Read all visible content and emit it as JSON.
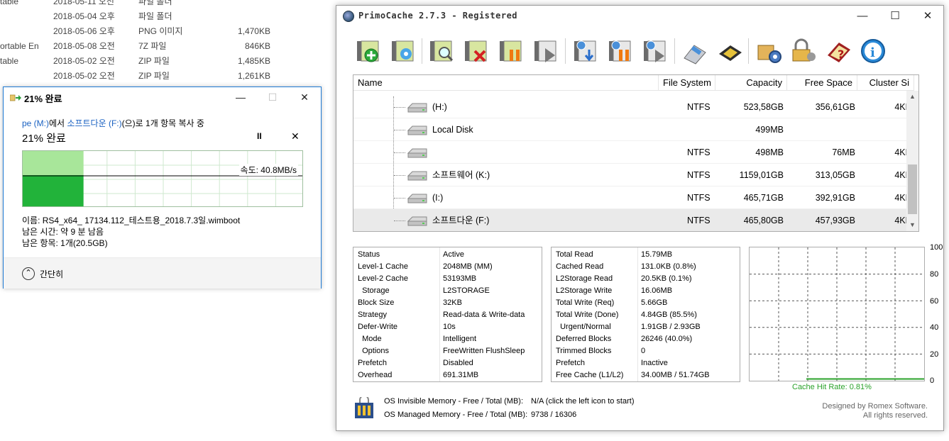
{
  "explorer": {
    "rows": [
      {
        "name": "table",
        "date": "2018-05-11 오전",
        "type": "파일 폴더",
        "size": ""
      },
      {
        "name": "",
        "date": "2018-05-04 오후",
        "type": "파일 폴더",
        "size": ""
      },
      {
        "name": "",
        "date": "2018-05-06 오후",
        "type": "PNG 이미지",
        "size": "1,470KB"
      },
      {
        "name": "ortable En",
        "date": "2018-05-08 오전",
        "type": "7Z 파일",
        "size": "846KB"
      },
      {
        "name": "table",
        "date": "2018-05-02 오전",
        "type": "ZIP 파일",
        "size": "1,485KB"
      },
      {
        "name": "",
        "date": "2018-05-02 오전",
        "type": "ZIP 파일",
        "size": "1,261KB"
      }
    ]
  },
  "copy_dialog": {
    "title": "21% 완료",
    "src_drive": "pe (M:)",
    "from_text": "에서 ",
    "dest_drive": "소프트다운 (F:)",
    "action_text": "(으)로 1개 항목 복사 중",
    "percent_text": "21% 완료",
    "pause_glyph": "II",
    "cancel_glyph": "✕",
    "speed_text": "속도: 40.8MB/s",
    "progress": 0.21,
    "name_line": "이름: RS4_x64_ 17134.112_테스트용_2018.7.3일.wimboot",
    "time_line": "남은 시간: 약 9 분 남음",
    "items_line": "남은 항목: 1개(20.5GB)",
    "collapse_label": "간단히",
    "caption": {
      "minimize": "—",
      "maximize": "☐",
      "close": "✕"
    }
  },
  "primo": {
    "title": "PrimoCache 2.7.3 - Registered",
    "caption": {
      "minimize": "—",
      "maximize": "☐",
      "close": "✕"
    },
    "toolbar": [
      "add-cache",
      "new-task",
      "inspect",
      "remove-cache",
      "pause-cache",
      "play-cache",
      "flush",
      "pause-all",
      "play-all",
      "tools",
      "hardware",
      "settings",
      "security",
      "help",
      "about"
    ],
    "table": {
      "columns": [
        "Name",
        "File System",
        "Capacity",
        "Free Space",
        "Cluster Si"
      ],
      "rows": [
        {
          "name": "(H:)",
          "fs": "NTFS",
          "capacity": "523,58GB",
          "free": "356,61GB",
          "cluster": "4KB",
          "selected": false
        },
        {
          "name": "Local Disk",
          "fs": "",
          "capacity": "499MB",
          "free": "",
          "cluster": "",
          "selected": false
        },
        {
          "name": "",
          "fs": "NTFS",
          "capacity": "498MB",
          "free": "76MB",
          "cluster": "4KB",
          "selected": false
        },
        {
          "name": "소프트웨어 (K:)",
          "fs": "NTFS",
          "capacity": "1159,01GB",
          "free": "313,05GB",
          "cluster": "4KB",
          "selected": false
        },
        {
          "name": "(I:)",
          "fs": "NTFS",
          "capacity": "465,71GB",
          "free": "392,91GB",
          "cluster": "4KB",
          "selected": false
        },
        {
          "name": "소프트다운 (F:)",
          "fs": "NTFS",
          "capacity": "465,80GB",
          "free": "457,93GB",
          "cluster": "4KB",
          "selected": true
        }
      ]
    },
    "status_left": [
      {
        "k": "Status",
        "v": "Active"
      },
      {
        "k": "Level-1 Cache",
        "v": "2048MB (MM)"
      },
      {
        "k": "Level-2 Cache",
        "v": "53193MB"
      },
      {
        "k": "  Storage",
        "v": "L2STORAGE"
      },
      {
        "k": "Block Size",
        "v": "32KB"
      },
      {
        "k": "Strategy",
        "v": "Read-data & Write-data"
      },
      {
        "k": "Defer-Write",
        "v": "10s"
      },
      {
        "k": "  Mode",
        "v": "Intelligent"
      },
      {
        "k": "  Options",
        "v": "FreeWritten FlushSleep"
      },
      {
        "k": "Prefetch",
        "v": "Disabled"
      },
      {
        "k": "Overhead",
        "v": "691.31MB"
      }
    ],
    "status_right": [
      {
        "k": "Total Read",
        "v": "15.79MB"
      },
      {
        "k": "Cached Read",
        "v": "131.0KB (0.8%)"
      },
      {
        "k": "L2Storage Read",
        "v": "20.5KB (0.1%)"
      },
      {
        "k": "L2Storage Write",
        "v": "16.06MB"
      },
      {
        "k": "Total Write (Req)",
        "v": "5.66GB"
      },
      {
        "k": "Total Write (Done)",
        "v": "4.84GB (85.5%)"
      },
      {
        "k": "  Urgent/Normal",
        "v": "1.91GB / 2.93GB"
      },
      {
        "k": "Deferred Blocks",
        "v": "26246 (40.0%)"
      },
      {
        "k": "Trimmed Blocks",
        "v": "0"
      },
      {
        "k": "Prefetch",
        "v": "Inactive"
      },
      {
        "k": "Free Cache (L1/L2)",
        "v": "34.00MB / 51.74GB"
      }
    ],
    "hit_graph": {
      "y_ticks": [
        "100",
        "80",
        "60",
        "40",
        "20",
        "0"
      ],
      "hit_rate_label": "Cache Hit Rate: 0.81%",
      "hit_rate": 0.81
    },
    "memory": {
      "invisible_label": "OS Invisible Memory - Free / Total (MB):",
      "invisible_value": "N/A (click the left icon to start)",
      "managed_label": "OS Managed Memory - Free / Total (MB):",
      "managed_value": "9738 / 16306"
    },
    "credit_line1": "Designed by Romex Software.",
    "credit_line2": "All rights reserved."
  }
}
